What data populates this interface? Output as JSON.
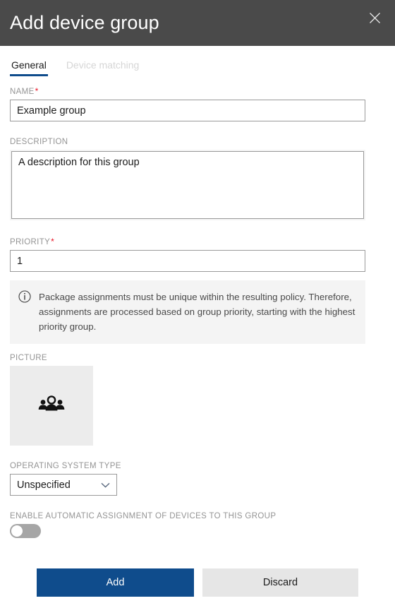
{
  "window": {
    "title": "Add device group",
    "close_icon": "close-icon",
    "header_bg": "#4a4a4a"
  },
  "tabs": [
    {
      "label": "General",
      "state": "active"
    },
    {
      "label": "Device matching",
      "state": "disabled"
    }
  ],
  "form": {
    "name": {
      "label": "NAME",
      "required": true,
      "value": "Example group",
      "placeholder": ""
    },
    "description": {
      "label": "DESCRIPTION",
      "required": false,
      "value": "A description for this group",
      "placeholder": ""
    },
    "priority": {
      "label": "PRIORITY",
      "required": true,
      "value": "1",
      "placeholder": ""
    },
    "info": {
      "icon": "info-circle-icon",
      "text": "Package assignments must be unique within the resulting policy. Therefore, assignments are processed based on group priority, starting with the highest priority group."
    },
    "picture": {
      "label": "PICTURE",
      "icon": "group-people-icon"
    },
    "operating_system_type": {
      "label": "OPERATING SYSTEM TYPE",
      "value": "Unspecified",
      "chevron_icon": "chevron-down-icon",
      "options": [
        "Unspecified"
      ]
    },
    "auto_assignment": {
      "label": "ENABLE AUTOMATIC ASSIGNMENT OF DEVICES TO THIS GROUP",
      "state": "off"
    }
  },
  "footer": {
    "add_label": "Add",
    "discard_label": "Discard"
  },
  "colors": {
    "accent": "#0f4c8c",
    "required_asterisk": "#e81123",
    "label_gray": "#949494",
    "info_bg": "#f4f4f4",
    "discard_bg": "#e6e6e6"
  }
}
